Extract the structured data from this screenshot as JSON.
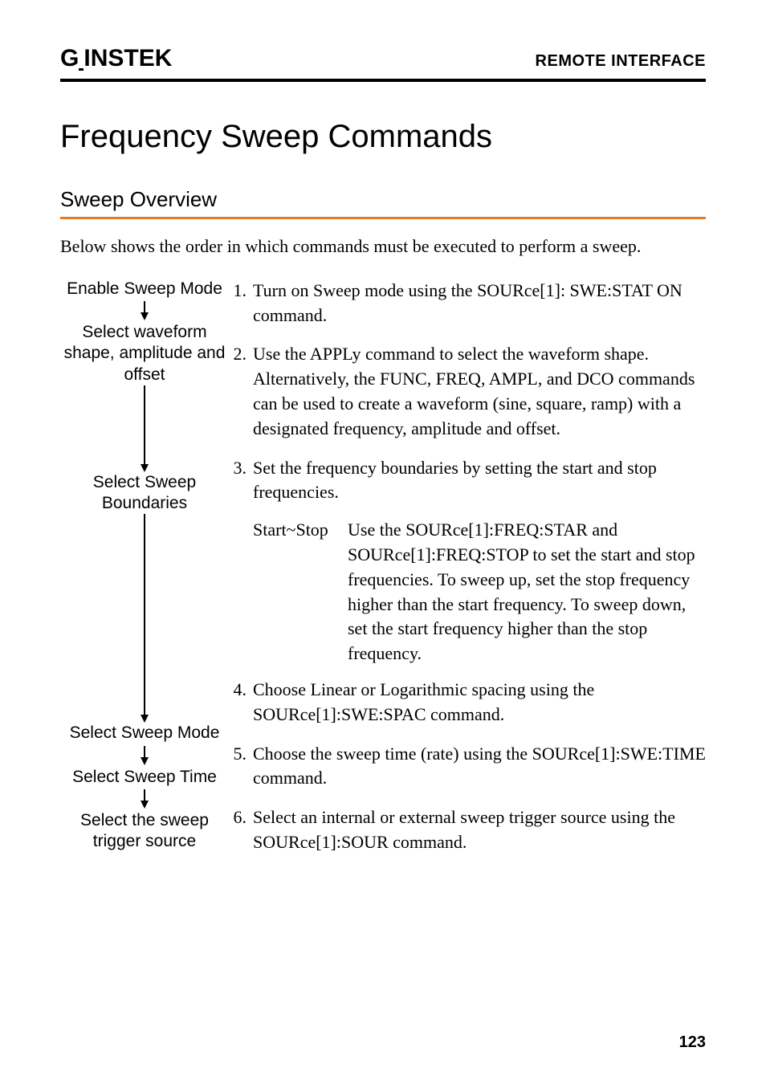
{
  "header": {
    "logo_text": "GWINSTEK",
    "section": "REMOTE INTERFACE"
  },
  "title": "Frequency Sweep Commands",
  "subtitle": "Sweep Overview",
  "intro": "Below shows the order in which commands must be executed to perform a sweep.",
  "flow_labels": {
    "s1": "Enable Sweep Mode",
    "s2": "Select waveform shape, amplitude and offset",
    "s3": "Select Sweep Boundaries",
    "s4": "Select Sweep Mode",
    "s5": "Select Sweep Time",
    "s6": "Select the sweep trigger source"
  },
  "steps": {
    "n1": "1.",
    "t1": "Turn on Sweep mode using the SOURce[1]: SWE:STAT ON command.",
    "n2": "2.",
    "t2": "Use the APPLy command to select the waveform shape. Alternatively, the FUNC, FREQ, AMPL, and DCO commands can be used to create a waveform (sine, square, ramp) with a designated frequency, amplitude and offset.",
    "n3": "3.",
    "t3": "Set the frequency boundaries by setting the start and stop frequencies.",
    "sub_label": "Start~Stop",
    "sub_body": "Use the SOURce[1]:FREQ:STAR and SOURce[1]:FREQ:STOP to set the start and stop frequencies. To sweep up, set the stop frequency higher than the start frequency. To sweep down, set the start frequency higher than the stop frequency.",
    "n4": "4.",
    "t4": "Choose Linear or Logarithmic spacing using the SOURce[1]:SWE:SPAC command.",
    "n5": "5.",
    "t5": "Choose the sweep time (rate) using the SOURce[1]:SWE:TIME command.",
    "n6": "6.",
    "t6": "Select an internal or external sweep trigger source using the SOURce[1]:SOUR command."
  },
  "page_number": "123"
}
